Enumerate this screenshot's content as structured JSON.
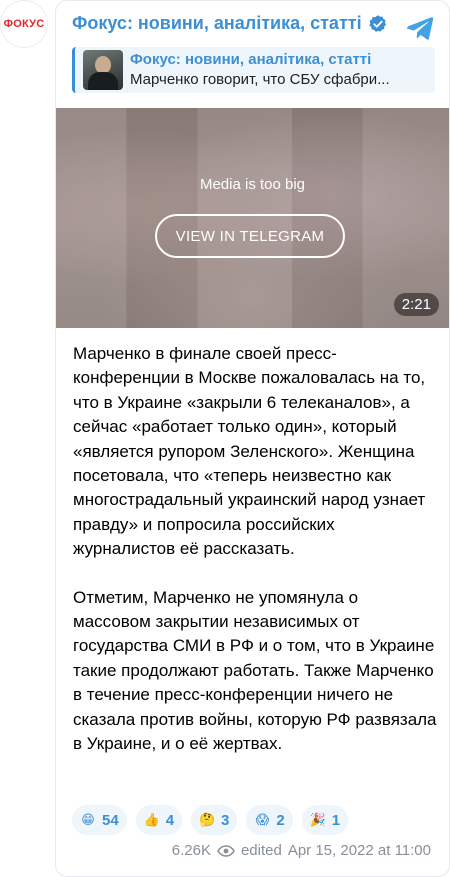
{
  "avatar": {
    "logo_text": "ФОКУС"
  },
  "channel": {
    "name": "Фокус: новини, аналітика, статті"
  },
  "reply": {
    "title": "Фокус: новини, аналітика, статті",
    "text": "Марченко говорит, что СБУ сфабри..."
  },
  "media": {
    "note": "Media is too big",
    "button_label": "VIEW IN TELEGRAM",
    "duration": "2:21"
  },
  "message": {
    "paragraphs": [
      "Марченко в финале своей пресс-конференции в Москве пожаловалась на то, что в Украине «закрыли 6 телеканалов», а сейчас «работает только один», который «является рупором Зеленского». Женщина посетовала, что «теперь неизвестно как многострадальный украинский народ узнает правду» и попросила российских журналистов её рассказать.",
      "Отметим, Марченко не упомянула о массовом закрытии независимых от государства СМИ в РФ и о том, что в Украине такие продолжают работать. Также Марченко в течение пресс-конференции ничего не сказала против войны, которую РФ развязала в Украине, и о её жертвах."
    ]
  },
  "reactions": [
    {
      "emoji": "😁",
      "icon": "grinning-face-icon",
      "count": "54"
    },
    {
      "emoji": "👍",
      "icon": "thumbs-up-icon",
      "count": "4"
    },
    {
      "emoji": "🤔",
      "icon": "thinking-face-icon",
      "count": "3"
    },
    {
      "emoji": "😱",
      "icon": "screaming-face-icon",
      "count": "2"
    },
    {
      "emoji": "🎉",
      "icon": "party-popper-icon",
      "count": "1"
    }
  ],
  "footer": {
    "views": "6.26K",
    "edited": "edited",
    "timestamp": "Apr 15, 2022 at 11:00"
  },
  "colors": {
    "accent": "#3d8fd3",
    "logo_red": "#e3262c",
    "reaction_bg": "#eef5fb",
    "meta": "#888f98"
  }
}
